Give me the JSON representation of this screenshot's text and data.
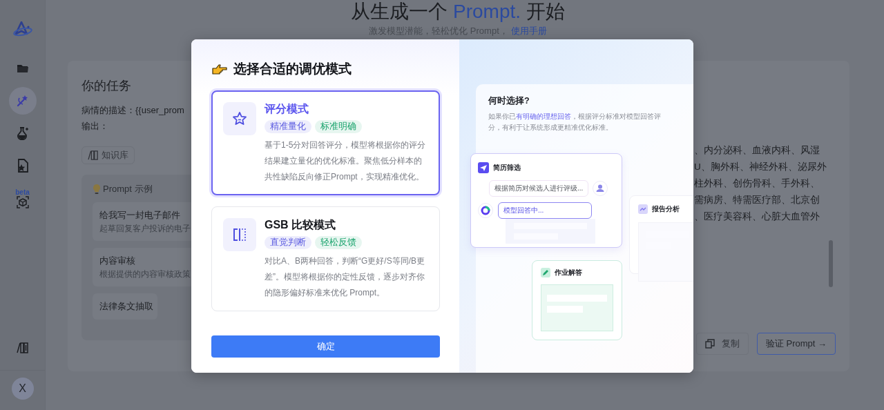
{
  "header": {
    "title_before": "从生成一个",
    "title_highlight": "Prompt.",
    "title_after": "开始",
    "subtitle": "激发模型潜能，轻松优化 Prompt，",
    "guide_link": "使用手册"
  },
  "sidebar": {
    "items": [
      {
        "kind": "folder",
        "selected": false
      },
      {
        "kind": "wand",
        "selected": true
      },
      {
        "kind": "flask",
        "selected": false
      },
      {
        "kind": "star-file",
        "selected": false
      },
      {
        "kind": "cube",
        "selected": false,
        "badge": "beta"
      }
    ],
    "bottom_items": [
      {
        "kind": "books",
        "selected": false
      }
    ],
    "avatar": "X"
  },
  "task_card": {
    "title": "你的任务",
    "lines": [
      "病情的描述：{{user_prom",
      "输出："
    ],
    "knowledge_button": "知识库",
    "examples": {
      "title": "Prompt 示例",
      "items": [
        {
          "title": "给我写一封电子邮件",
          "description": "起草回复客户投诉的电子"
        },
        {
          "title": "内容审核",
          "description": "根据提供的内容审核政策"
        },
        {
          "title": "法律条文抽取"
        }
      ]
    }
  },
  "result_card": {
    "lines": [
      "、内分泌科、血液内科、风湿",
      "U、胸外科、神经外科、泌尿外",
      "柱外科、创伤骨科、手外科、",
      "需病房、特需医疗部、北京创",
      "、医疗美容科、心脏大血管外"
    ],
    "copy_button": "复制",
    "verify_button": "验证 Prompt →"
  },
  "modal": {
    "title": "选择合适的调优模式",
    "modes": [
      {
        "kind": "score",
        "title": "评分模式",
        "selected": true,
        "tags": [
          {
            "label": "精准量化",
            "color": "#5b5be0"
          },
          {
            "label": "标准明确",
            "color": "#17a26b"
          }
        ],
        "description": "基于1-5分对回答评分，模型将根据你的评分结果建立量化的优化标准。聚焦低分样本的共性缺陷反向修正Prompt，实现精准优化。"
      },
      {
        "kind": "gsb",
        "title": "GSB 比较模式",
        "selected": false,
        "tags": [
          {
            "label": "直觉判断",
            "color": "#5b5be0"
          },
          {
            "label": "轻松反馈",
            "color": "#17a26b"
          }
        ],
        "description": "对比A、B两种回答，判断“G更好/S等同/B更差”。模型将根据你的定性反馈，逐步对齐你的隐形偏好标准来优化 Prompt。"
      }
    ],
    "confirm_button": "确定",
    "info": {
      "title": "何时选择?",
      "description_before": "如果你已",
      "description_highlight": "有明确的理想回答",
      "description_after": "，根据评分标准对模型回答评分，有利于让系统形成更精准优化标准。"
    },
    "illustration": {
      "resume_card": {
        "title": "简历筛选",
        "question": "根据简历对候选人进行评级...",
        "answer": "模型回答中..."
      },
      "report_card": {
        "title": "报告分析"
      },
      "homework_card": {
        "title": "作业解答"
      }
    }
  }
}
